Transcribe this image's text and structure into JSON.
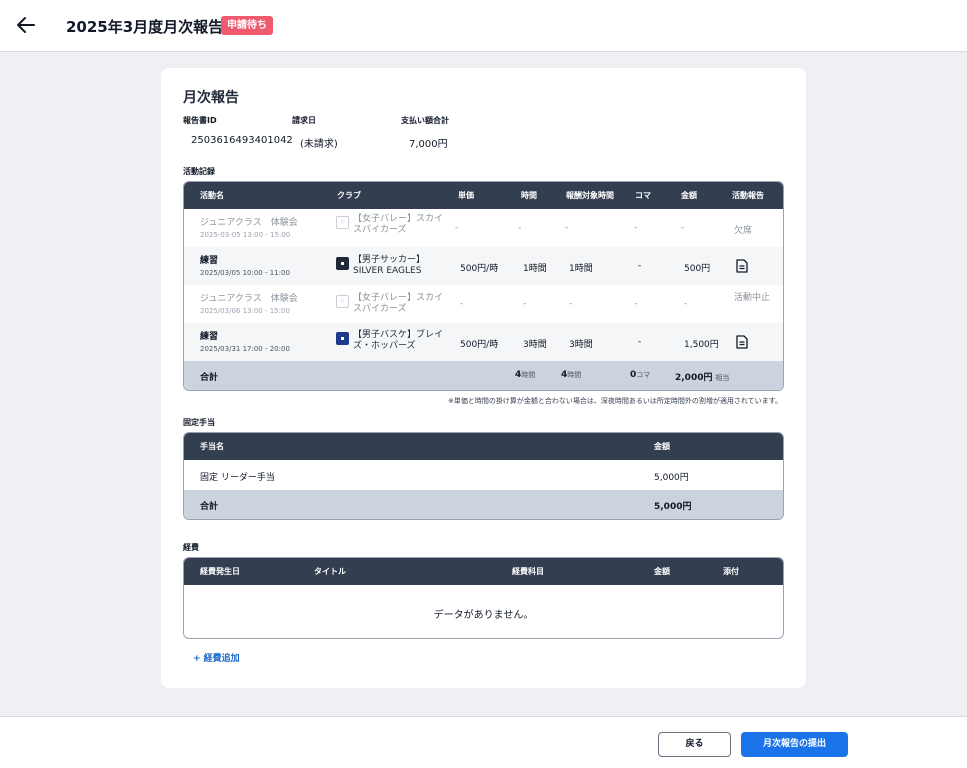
{
  "header": {
    "title": "2025年3月度月次報告",
    "status_badge": "申請待ち"
  },
  "report": {
    "card_title": "月次報告",
    "meta": {
      "id_label": "報告書ID",
      "id_value": "2503616493401042",
      "billing_date_label": "請求日",
      "billing_date_value": "(未請求)",
      "payment_total_label": "支払い額合計",
      "payment_total_value": "7,000円"
    }
  },
  "activities": {
    "section_label": "活動記録",
    "columns": [
      "活動名",
      "クラブ",
      "単価",
      "時間",
      "報酬対象時間",
      "コマ",
      "金額",
      "活動報告"
    ],
    "rows": [
      {
        "name": "ジュニアクラス　体験会",
        "datetime": "2025-03-05 13:00 - 15:00",
        "club": "【女子バレー】スカイスパイカーズ",
        "unit_price": "-",
        "hours": "-",
        "paid_hours": "-",
        "koma": "-",
        "amount": "-",
        "report": "欠席"
      },
      {
        "name": "練習",
        "datetime": "2025/03/05 10:00 - 11:00",
        "club": "【男子サッカー】SILVER EAGLES",
        "unit_price": "500円/時",
        "hours": "1時間",
        "paid_hours": "1時間",
        "koma": "-",
        "amount": "500円",
        "report_icon": "document-icon"
      },
      {
        "name": "ジュニアクラス　体験会",
        "datetime": "2025/03/06 13:00 - 15:00",
        "club": "【女子バレー】スカイスパイカーズ",
        "unit_price": "-",
        "hours": "-",
        "paid_hours": "-",
        "koma": "-",
        "amount": "-",
        "report": "活動中止"
      },
      {
        "name": "練習",
        "datetime": "2025/03/31 17:00 - 20:00",
        "club": "【男子バスケ】ブレイズ・ホッパーズ",
        "unit_price": "500円/時",
        "hours": "3時間",
        "paid_hours": "3時間",
        "koma": "-",
        "amount": "1,500円",
        "report_icon": "document-icon"
      }
    ],
    "total": {
      "label": "合計",
      "hours": "4",
      "hours_unit": "時間",
      "paid_hours": "4",
      "paid_hours_unit": "時間",
      "koma": "0",
      "koma_unit": "コマ",
      "amount": "2,000円",
      "amount_suffix": "相当"
    },
    "note": "※単価と時間の掛け算が金額と合わない場合は、深夜時間あるいは所定時間外の割増が適用されています。"
  },
  "allowances": {
    "section_label": "固定手当",
    "columns": [
      "手当名",
      "金額"
    ],
    "rows": [
      {
        "name": "固定 リーダー手当",
        "amount": "5,000円"
      }
    ],
    "total": {
      "label": "合計",
      "amount": "5,000円"
    }
  },
  "expenses": {
    "section_label": "経費",
    "columns": [
      "経費発生日",
      "タイトル",
      "経費科目",
      "金額",
      "添付"
    ],
    "empty_message": "データがありません。",
    "add_label": "+ 経費追加"
  },
  "footer": {
    "back_label": "戻る",
    "submit_label": "月次報告の提出"
  },
  "colors": {
    "badge": "#ef5a6f",
    "table_header": "#333f50",
    "total_row": "#cbd3de",
    "primary": "#1a73e8",
    "link": "#2068c9"
  }
}
